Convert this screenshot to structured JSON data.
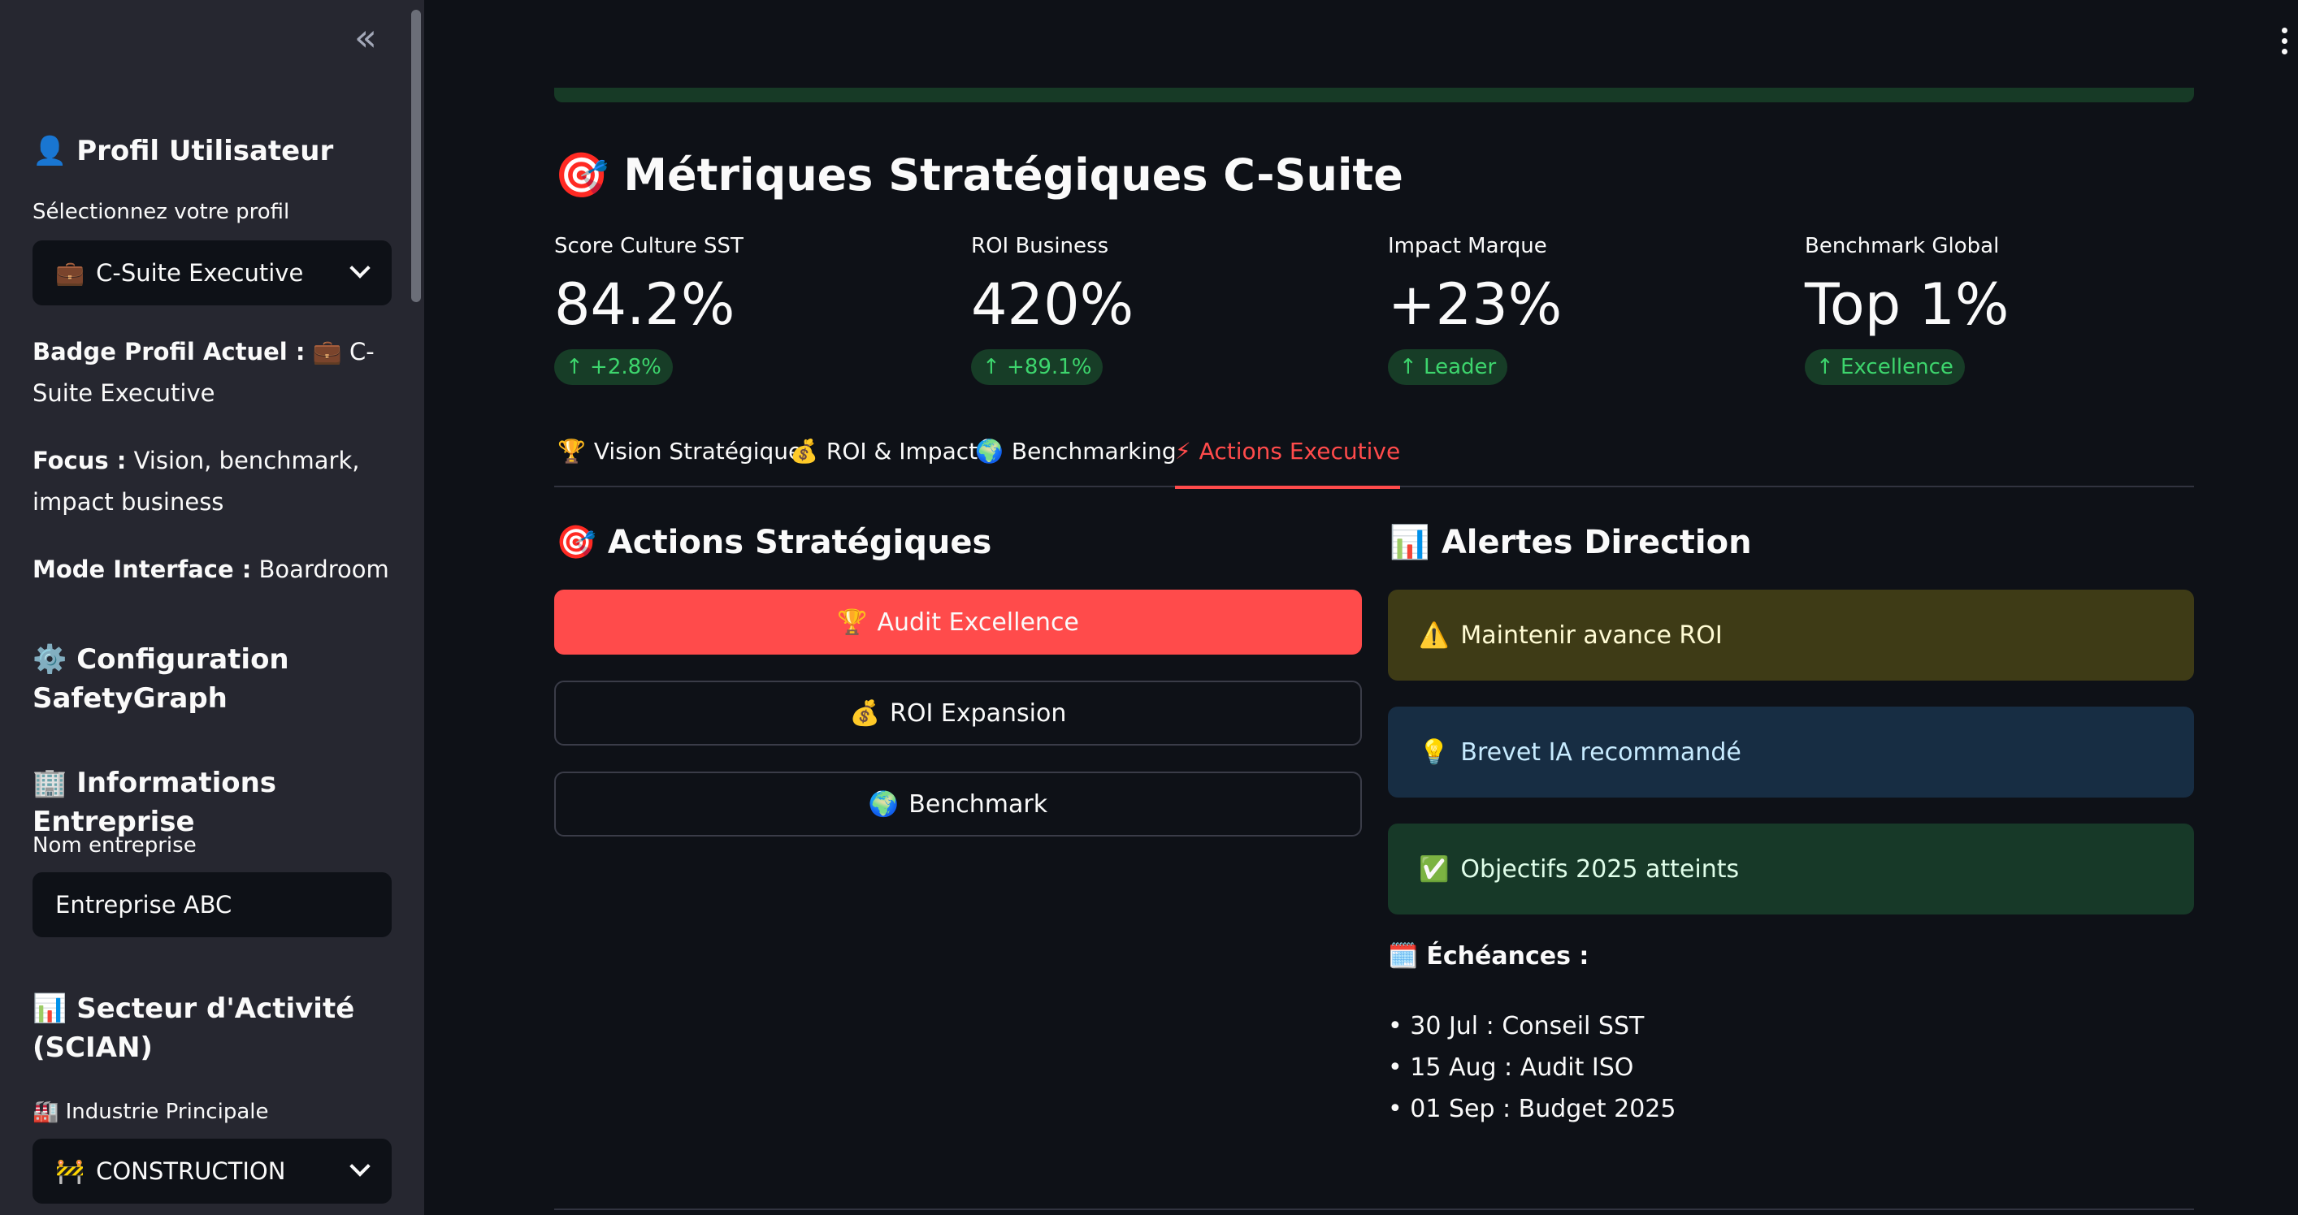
{
  "sidebar": {
    "collapse_icon": "«",
    "profile_heading": {
      "icon": "👤",
      "text": "Profil Utilisateur"
    },
    "profile_select_label": "Sélectionnez votre profil",
    "profile_select_value": {
      "icon": "💼",
      "text": "C-Suite Executive"
    },
    "badge": {
      "label": "Badge Profil Actuel :",
      "value": "💼 C-Suite Executive"
    },
    "focus": {
      "label": "Focus :",
      "value": "Vision, benchmark, impact business"
    },
    "mode": {
      "label": "Mode Interface :",
      "value": "Boardroom"
    },
    "config_heading": {
      "icon": "⚙️",
      "text": "Configuration SafetyGraph"
    },
    "company_heading": {
      "icon": "🏢",
      "text": "Informations Entreprise"
    },
    "company_label": "Nom entreprise",
    "company_value": "Entreprise ABC",
    "sector_heading": {
      "icon": "📊",
      "text": "Secteur d'Activité (SCIAN)"
    },
    "industry_label": {
      "icon": "🏭",
      "text": "Industrie Principale"
    },
    "industry_value": {
      "icon": "🚧",
      "text": "CONSTRUCTION"
    }
  },
  "main": {
    "title": {
      "icon": "🎯",
      "text": "Métriques Stratégiques C-Suite"
    },
    "metrics": [
      {
        "label": "Score Culture SST",
        "value": "84.2%",
        "delta": "↑ +2.8%"
      },
      {
        "label": "ROI Business",
        "value": "420%",
        "delta": "↑ +89.1%"
      },
      {
        "label": "Impact Marque",
        "value": "+23%",
        "delta": "↑ Leader"
      },
      {
        "label": "Benchmark Global",
        "value": "Top 1%",
        "delta": "↑ Excellence"
      }
    ],
    "tabs": [
      {
        "icon": "🏆",
        "label": "Vision Stratégique"
      },
      {
        "icon": "💰",
        "label": "ROI & Impact"
      },
      {
        "icon": "🌍",
        "label": "Benchmarking"
      },
      {
        "icon": "⚡",
        "label": "Actions Executive"
      }
    ],
    "actions": {
      "heading": {
        "icon": "🎯",
        "text": "Actions Stratégiques"
      },
      "buttons": [
        {
          "icon": "🏆",
          "label": "Audit Excellence"
        },
        {
          "icon": "💰",
          "label": "ROI Expansion"
        },
        {
          "icon": "🌍",
          "label": "Benchmark"
        }
      ]
    },
    "alerts": {
      "heading": {
        "icon": "📊",
        "text": "Alertes Direction"
      },
      "items": [
        {
          "icon": "⚠️",
          "text": "Maintenir avance ROI"
        },
        {
          "icon": "💡",
          "text": "Brevet IA recommandé"
        },
        {
          "icon": "✅",
          "text": "Objectifs 2025 atteints"
        }
      ],
      "deadlines_title": {
        "icon": "🗓️",
        "text": "Échéances :"
      },
      "deadlines": [
        "• 30 Jul : Conseil SST",
        "• 15 Aug : Audit ISO",
        "• 01 Sep : Budget 2025"
      ]
    }
  },
  "colors": {
    "background": "#0e1117",
    "sidebar": "#262730",
    "accent": "#ff4b4b",
    "delta_green": "#3dd56d"
  }
}
